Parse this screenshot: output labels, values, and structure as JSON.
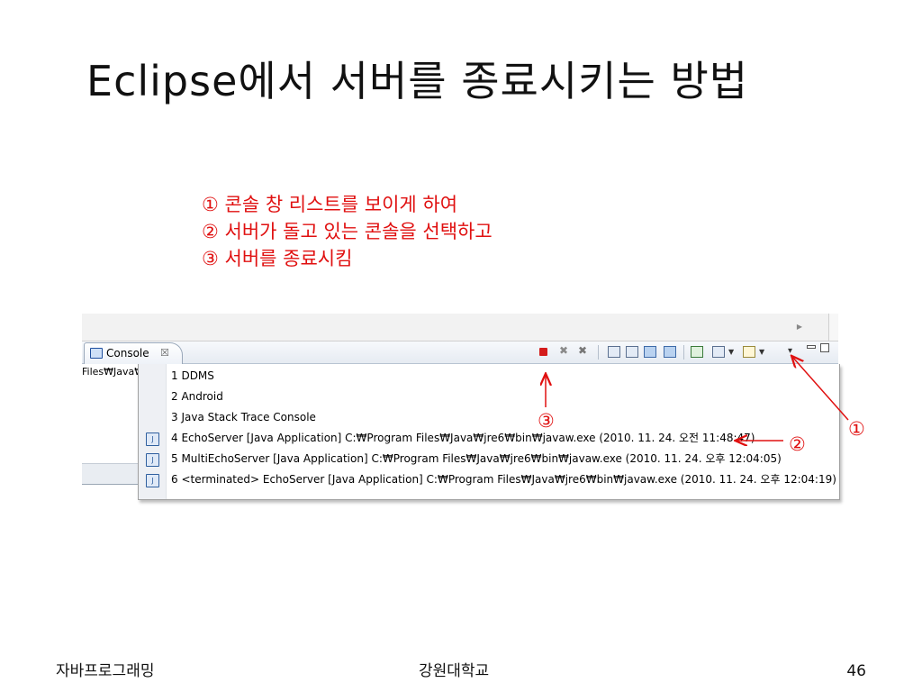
{
  "slide": {
    "title": "Eclipse에서 서버를 종료시키는 방법",
    "steps": [
      "① 콘솔 창 리스트를 보이게 하여",
      "② 서버가 돌고 있는 콘솔을 선택하고",
      "③ 서버를 종료시킴"
    ]
  },
  "console": {
    "tab_label": "Console",
    "tab_close": "☒",
    "left_pane_text": "Files₩Java₩",
    "menu_items": [
      {
        "label": "1 DDMS",
        "icon": ""
      },
      {
        "label": "2 Android",
        "icon": ""
      },
      {
        "label": "3 Java Stack Trace Console",
        "icon": ""
      },
      {
        "label": "4 EchoServer [Java Application] C:₩Program Files₩Java₩jre6₩bin₩javaw.exe (2010. 11. 24. 오전 11:48:47)",
        "icon": "java-console-icon"
      },
      {
        "label": "5 MultiEchoServer [Java Application] C:₩Program Files₩Java₩jre6₩bin₩javaw.exe (2010. 11. 24. 오후 12:04:05)",
        "icon": "java-console-icon"
      },
      {
        "label": "6 <terminated> EchoServer [Java Application] C:₩Program Files₩Java₩jre6₩bin₩javaw.exe (2010. 11. 24. 오후 12:04:19)",
        "icon": "java-console-icon"
      }
    ],
    "toolbar_icons": [
      "terminate-icon",
      "remove-launch-icon",
      "remove-all-icon",
      "clear-console-icon",
      "scroll-lock-icon",
      "show-on-stdout-icon",
      "show-on-stderr-icon",
      "pin-console-icon",
      "display-console-icon",
      "open-console-icon",
      "view-menu-icon",
      "minimize-icon",
      "maximize-icon"
    ]
  },
  "annotations": {
    "mark1": "①",
    "mark2": "②",
    "mark3": "③",
    "color": "#e01010"
  },
  "footer": {
    "left": "자바프로그래밍",
    "center": "강원대학교",
    "page": "46"
  }
}
